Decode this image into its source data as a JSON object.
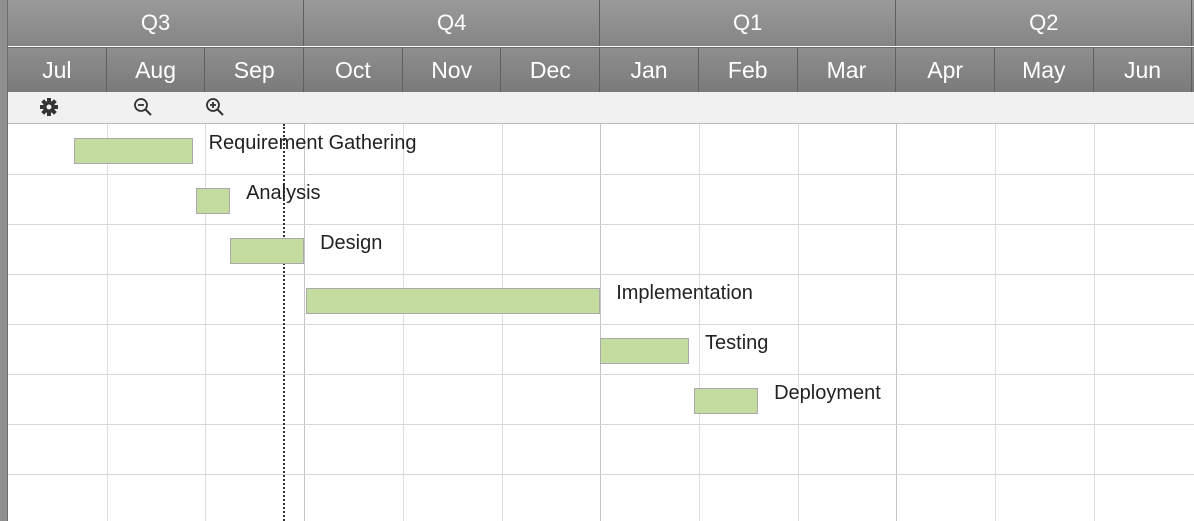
{
  "timeline": {
    "quarters": [
      "Q3",
      "Q4",
      "Q1",
      "Q2"
    ],
    "months": [
      "Jul",
      "Aug",
      "Sep",
      "Oct",
      "Nov",
      "Dec",
      "Jan",
      "Feb",
      "Mar",
      "Apr",
      "May",
      "Jun"
    ]
  },
  "toolbar": {
    "settings_icon": "gear-icon",
    "zoom_out_icon": "zoom-out-icon",
    "zoom_in_icon": "zoom-in-icon"
  },
  "tasks": [
    {
      "name": "Requirement Gathering",
      "start_month": 0.67,
      "end_month": 1.87
    },
    {
      "name": "Analysis",
      "start_month": 1.9,
      "end_month": 2.25
    },
    {
      "name": "Design",
      "start_month": 2.25,
      "end_month": 3.0
    },
    {
      "name": "Implementation",
      "start_month": 3.02,
      "end_month": 6.0
    },
    {
      "name": "Testing",
      "start_month": 6.0,
      "end_month": 6.9
    },
    {
      "name": "Deployment",
      "start_month": 6.95,
      "end_month": 7.6
    }
  ],
  "today_marker_month": 2.8,
  "colors": {
    "header": "#8a8a8a",
    "header_text": "#ffffff",
    "task_bar": "#c4dc9f",
    "grid_line": "#dddddd"
  }
}
